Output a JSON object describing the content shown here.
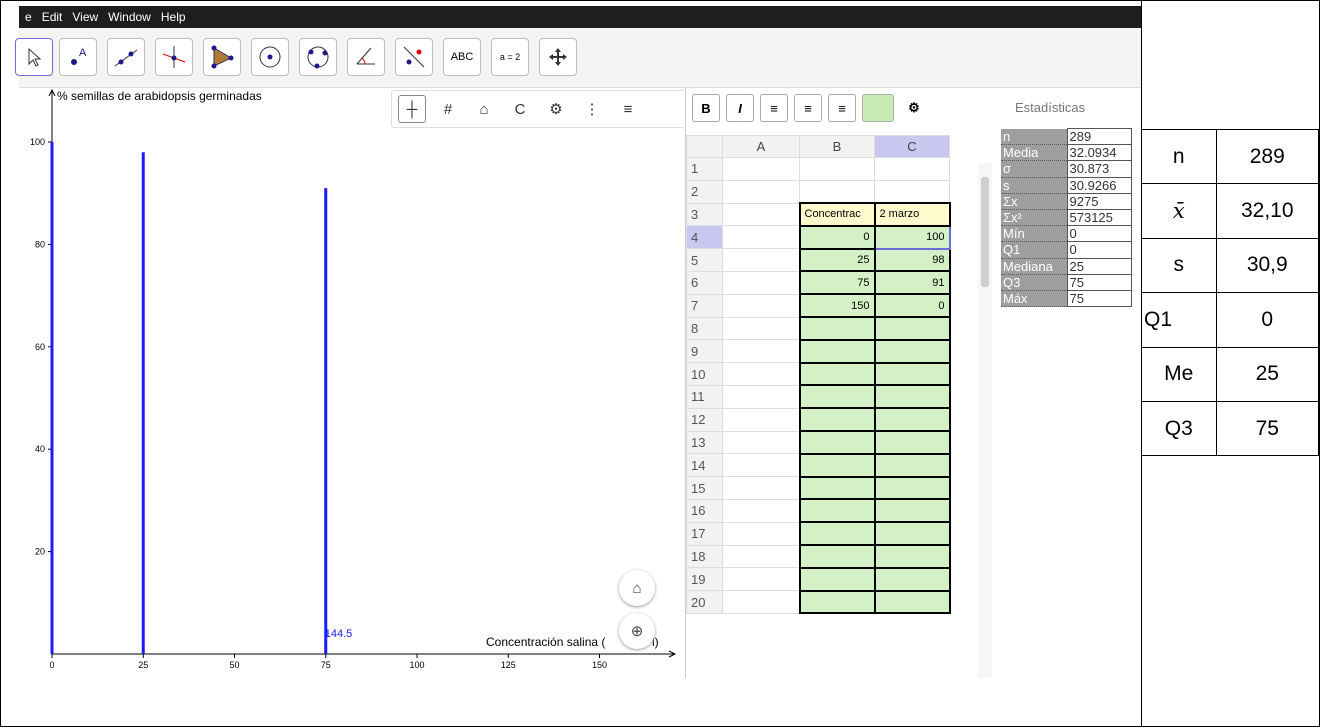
{
  "menu": [
    "e",
    "Edit",
    "View",
    "Window",
    "Help"
  ],
  "toolbar": {
    "text_tool": "ABC",
    "slider_tool": "a = 2"
  },
  "graphics": {
    "y_axis_label": "% semillas de arabidopsis germinadas",
    "x_axis_label": "Concentración salina (",
    "x_axis_label_tail": "l)",
    "point_label": "144.5"
  },
  "chart_data": {
    "type": "bar",
    "x": [
      0,
      25,
      75
    ],
    "values": [
      100,
      98,
      91
    ],
    "categories": [
      "0",
      "25",
      "75"
    ],
    "xlim": [
      0,
      165
    ],
    "ylim": [
      0,
      105
    ],
    "x_ticks": [
      "0",
      "25",
      "50",
      "75",
      "100",
      "125",
      "150"
    ],
    "y_ticks": [
      "20",
      "40",
      "60",
      "80",
      "100"
    ],
    "ylabel": "% semillas de arabidopsis germinadas",
    "xlabel": "Concentración salina (",
    "color": "#1a1aff"
  },
  "sheet": {
    "columns": [
      "A",
      "B",
      "C"
    ],
    "rows": [
      "1",
      "2",
      "3",
      "4",
      "5",
      "6",
      "7",
      "8",
      "9",
      "10",
      "11",
      "12",
      "13",
      "14",
      "15",
      "16",
      "17",
      "18",
      "19",
      "20"
    ],
    "b3": "Concentrac",
    "c3": "2 marzo",
    "data": [
      [
        "0",
        "100"
      ],
      [
        "25",
        "98"
      ],
      [
        "75",
        "91"
      ],
      [
        "150",
        "0"
      ]
    ]
  },
  "stats": {
    "title": "Estadísticas",
    "rows": [
      {
        "k": "n",
        "v": "289"
      },
      {
        "k": "Media",
        "v": "32.0934"
      },
      {
        "k": "σ",
        "v": "30.873"
      },
      {
        "k": "s",
        "v": "30.9266"
      },
      {
        "k": "Σx",
        "v": "9275"
      },
      {
        "k": "Σx²",
        "v": "573125"
      },
      {
        "k": "Mín",
        "v": "0"
      },
      {
        "k": "Q1",
        "v": "0"
      },
      {
        "k": "Mediana",
        "v": "25"
      },
      {
        "k": "Q3",
        "v": "75"
      },
      {
        "k": "Máx",
        "v": "75"
      }
    ]
  },
  "summary": [
    {
      "k": "n",
      "v": "289"
    },
    {
      "k": "x̄",
      "v": "32,10"
    },
    {
      "k": "s",
      "v": "30,9"
    },
    {
      "k": "Q1",
      "v": "0"
    },
    {
      "k": "Me",
      "v": "25"
    },
    {
      "k": "Q3",
      "v": "75"
    }
  ],
  "colors": {
    "menubar": "#1e1e1e",
    "bars": "#1a1aff",
    "cell_green": "#d4f0c6",
    "cell_yellow": "#fffacd",
    "selected": "#6b6bd9"
  }
}
